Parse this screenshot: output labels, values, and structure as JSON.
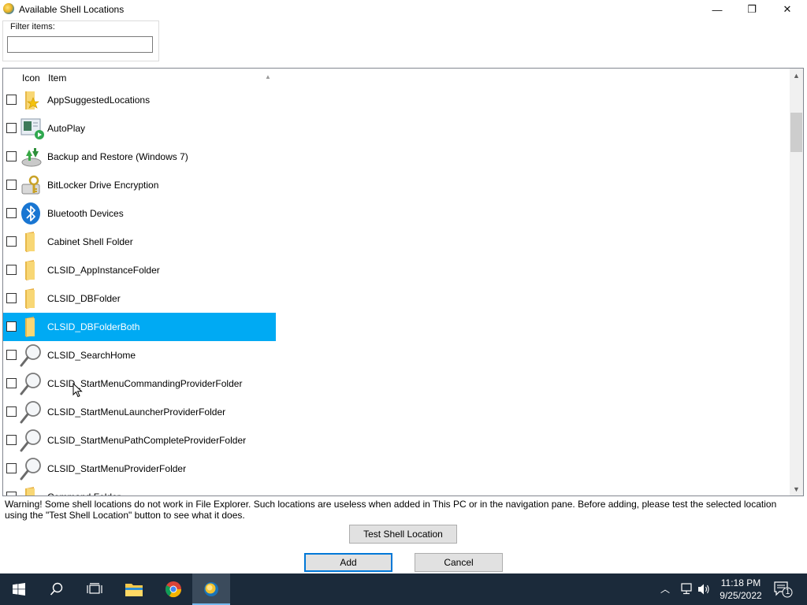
{
  "window": {
    "title": "Available Shell Locations",
    "minimize_glyph": "—",
    "maximize_glyph": "❐",
    "close_glyph": "✕"
  },
  "filter": {
    "label": "Filter items:",
    "value": ""
  },
  "list": {
    "columns": {
      "icon": "Icon",
      "item": "Item"
    },
    "sort_glyph": "▲",
    "rows": [
      {
        "label": "AppSuggestedLocations",
        "icon": "star-folder-icon",
        "checked": false,
        "selected": false
      },
      {
        "label": "AutoPlay",
        "icon": "autoplay-icon",
        "checked": false,
        "selected": false
      },
      {
        "label": "Backup and Restore (Windows 7)",
        "icon": "backup-restore-icon",
        "checked": false,
        "selected": false
      },
      {
        "label": "BitLocker Drive Encryption",
        "icon": "bitlocker-key-icon",
        "checked": false,
        "selected": false
      },
      {
        "label": "Bluetooth Devices",
        "icon": "bluetooth-icon",
        "checked": false,
        "selected": false
      },
      {
        "label": "Cabinet Shell Folder",
        "icon": "folder-icon",
        "checked": false,
        "selected": false
      },
      {
        "label": "CLSID_AppInstanceFolder",
        "icon": "folder-icon",
        "checked": false,
        "selected": false
      },
      {
        "label": "CLSID_DBFolder",
        "icon": "folder-icon",
        "checked": false,
        "selected": false
      },
      {
        "label": "CLSID_DBFolderBoth",
        "icon": "folder-icon",
        "checked": false,
        "selected": true
      },
      {
        "label": "CLSID_SearchHome",
        "icon": "magnifier-icon",
        "checked": false,
        "selected": false
      },
      {
        "label": "CLSID_StartMenuCommandingProviderFolder",
        "icon": "magnifier-icon",
        "checked": false,
        "selected": false
      },
      {
        "label": "CLSID_StartMenuLauncherProviderFolder",
        "icon": "magnifier-icon",
        "checked": false,
        "selected": false
      },
      {
        "label": "CLSID_StartMenuPathCompleteProviderFolder",
        "icon": "magnifier-icon",
        "checked": false,
        "selected": false
      },
      {
        "label": "CLSID_StartMenuProviderFolder",
        "icon": "magnifier-icon",
        "checked": false,
        "selected": false
      },
      {
        "label": "Command Folder",
        "icon": "folder-icon",
        "checked": false,
        "selected": false
      }
    ],
    "scroll_up_glyph": "▲",
    "scroll_down_glyph": "▼"
  },
  "warning": "Warning! Some shell locations do not work in File Explorer. Such locations are useless when added in This PC or in the navigation pane. Before adding, please test the selected location using the \"Test Shell Location\" button to see what it does.",
  "buttons": {
    "test": "Test Shell Location",
    "add": "Add",
    "cancel": "Cancel"
  },
  "taskbar": {
    "time": "11:18 PM",
    "date": "9/25/2022",
    "notification_count": "1",
    "tray_chevron": "︿"
  },
  "colors": {
    "selection": "#00aaf3",
    "taskbar": "#1b2a3a",
    "folder": "#f8d775"
  }
}
